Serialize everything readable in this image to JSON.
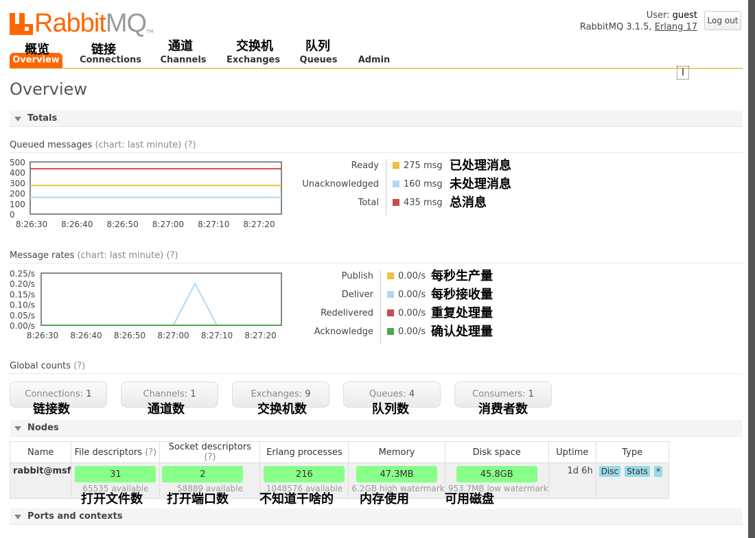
{
  "app": {
    "logo_word": "Rabbit",
    "logo_mq": "MQ",
    "logo_tm": "TM"
  },
  "user": {
    "label": "User:",
    "name": "guest",
    "version_text": "RabbitMQ 3.1.5,",
    "erlang": "Erlang 17",
    "logout": "Log out"
  },
  "nav": [
    {
      "label": "Overview",
      "cn": "概览",
      "active": true
    },
    {
      "label": "Connections",
      "cn": "链接"
    },
    {
      "label": "Channels",
      "cn": "通道"
    },
    {
      "label": "Exchanges",
      "cn": "交换机"
    },
    {
      "label": "Queues",
      "cn": "队列"
    },
    {
      "label": "Admin",
      "cn": ""
    }
  ],
  "page_title": "Overview",
  "sections": {
    "totals": "Totals",
    "nodes": "Nodes",
    "ports": "Ports and contexts"
  },
  "queued": {
    "title": "Queued messages",
    "chart_note": "(chart: last minute)",
    "help": "(?)",
    "legend": [
      {
        "label": "Ready",
        "value": "275 msg",
        "color": "#edc240",
        "cn": "已处理消息"
      },
      {
        "label": "Unacknowledged",
        "value": "160 msg",
        "color": "#afd8f8",
        "cn": "未处理消息"
      },
      {
        "label": "Total",
        "value": "435 msg",
        "color": "#cb4b4b",
        "cn": "总消息"
      }
    ]
  },
  "rates": {
    "title": "Message rates",
    "chart_note": "(chart: last minute)",
    "help": "(?)",
    "legend": [
      {
        "label": "Publish",
        "value": "0.00/s",
        "color": "#edc240",
        "cn": "每秒生产量"
      },
      {
        "label": "Deliver",
        "value": "0.00/s",
        "color": "#afd8f8",
        "cn": "每秒接收量"
      },
      {
        "label": "Redelivered",
        "value": "0.00/s",
        "color": "#cb4b4b",
        "cn": "重复处理量"
      },
      {
        "label": "Acknowledge",
        "value": "0.00/s",
        "color": "#4da74d",
        "cn": "确认处理量"
      }
    ]
  },
  "chart_data": [
    {
      "type": "line",
      "x": [
        "8:26:30",
        "8:26:40",
        "8:26:50",
        "8:27:00",
        "8:27:10",
        "8:27:20"
      ],
      "ylim": [
        0,
        500
      ],
      "yticks": [
        "500",
        "400",
        "300",
        "200",
        "100",
        "0"
      ],
      "series": [
        {
          "name": "Ready",
          "color": "#edc240",
          "values": [
            275,
            275,
            275,
            275,
            275,
            275
          ]
        },
        {
          "name": "Unacknowledged",
          "color": "#afd8f8",
          "values": [
            160,
            160,
            160,
            160,
            160,
            160
          ]
        },
        {
          "name": "Total",
          "color": "#cb4b4b",
          "values": [
            435,
            435,
            435,
            435,
            435,
            435
          ]
        }
      ]
    },
    {
      "type": "line",
      "x": [
        "8:26:30",
        "8:26:40",
        "8:26:50",
        "8:27:00",
        "8:27:10",
        "8:27:20"
      ],
      "ylim": [
        0,
        0.25
      ],
      "yticks": [
        "0.25/s",
        "0.20/s",
        "0.15/s",
        "0.10/s",
        "0.05/s",
        "0.00/s"
      ],
      "series": [
        {
          "name": "Deliver",
          "color": "#afd8f8",
          "points": [
            [
              0,
              0
            ],
            [
              3,
              0
            ],
            [
              3.5,
              0.2
            ],
            [
              4,
              0
            ],
            [
              5.5,
              0
            ]
          ]
        },
        {
          "name": "Acknowledge",
          "color": "#4da74d",
          "points": [
            [
              0,
              0
            ],
            [
              5.5,
              0
            ]
          ]
        }
      ]
    }
  ],
  "global": {
    "title": "Global counts",
    "help": "(?)",
    "items": [
      {
        "label": "Connections:",
        "value": "1",
        "cn": "链接数"
      },
      {
        "label": "Channels:",
        "value": "1",
        "cn": "通道数"
      },
      {
        "label": "Exchanges:",
        "value": "9",
        "cn": "交换机数"
      },
      {
        "label": "Queues:",
        "value": "4",
        "cn": "队列数"
      },
      {
        "label": "Consumers:",
        "value": "1",
        "cn": "消费者数"
      }
    ]
  },
  "nodes": {
    "headers": [
      "Name",
      "File descriptors",
      "Socket descriptors",
      "Erlang processes",
      "Memory",
      "Disk space",
      "Uptime",
      "Type"
    ],
    "help": "(?)",
    "row": {
      "name": "rabbit@msf",
      "fd": "31",
      "fd_sub": "65535 available",
      "fd_cn": "打开文件数",
      "sd": "2",
      "sd_sub": "58889 available",
      "sd_cn": "打开端口数",
      "ep": "216",
      "ep_sub": "1048576 available",
      "ep_cn": "不知道干啥的",
      "mem": "47.3MB",
      "mem_sub": "6.2GB high watermark",
      "mem_cn": "内存使用",
      "disk": "45.8GB",
      "disk_sub": "953.7MB low watermark",
      "disk_cn": "可用磁盘",
      "uptime": "1d 6h",
      "types": [
        "Disc",
        "Stats",
        "*"
      ]
    }
  }
}
